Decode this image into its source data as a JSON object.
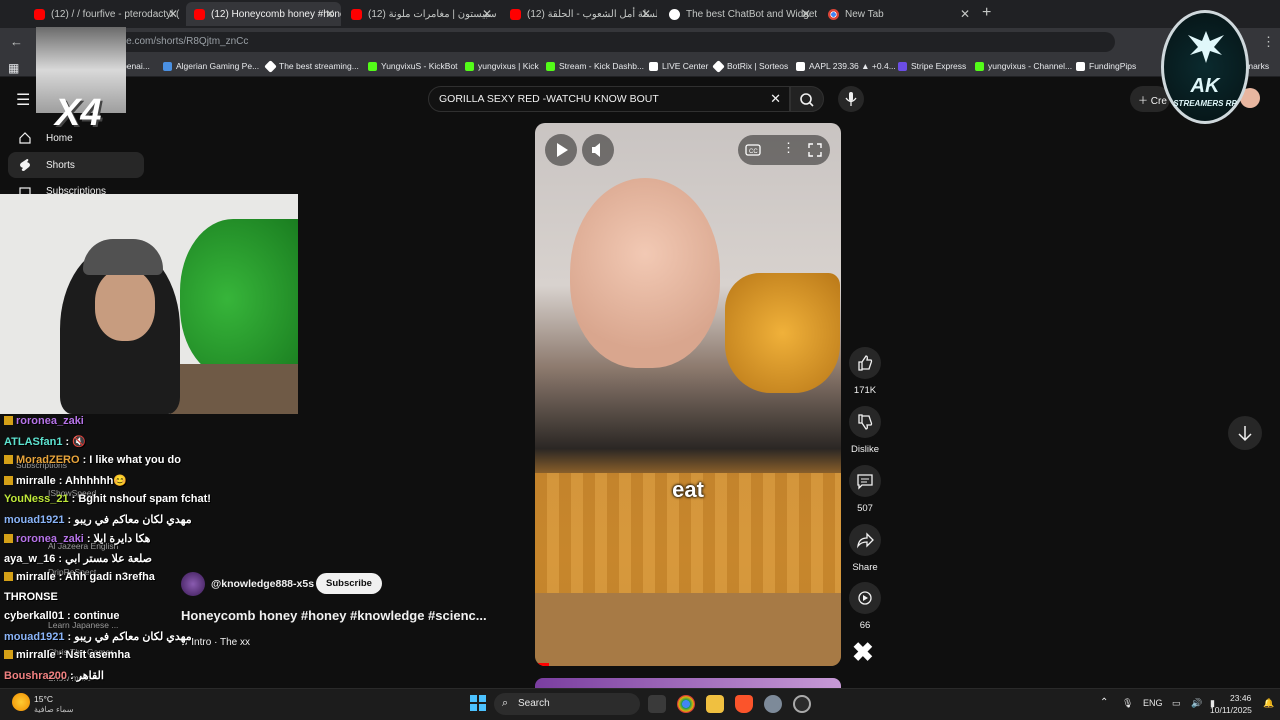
{
  "browser": {
    "tabs": [
      {
        "label": "(12) / / fourfive - pterodactyl (",
        "active": false,
        "icon": "youtube-icon"
      },
      {
        "label": "(12) Honeycomb honey #honey",
        "active": true,
        "icon": "youtube-icon"
      },
      {
        "label": "(12) سبيستون | مغامرات ملونة -",
        "active": false,
        "icon": "youtube-icon"
      },
      {
        "label": "(12) سلسلة أمل الشعوب - الحلقة",
        "active": false,
        "icon": "youtube-icon"
      },
      {
        "label": "The best ChatBot and Widgets",
        "active": false,
        "icon": "streamelements-icon"
      },
      {
        "label": "New Tab",
        "active": false,
        "icon": "chrome-icon"
      }
    ],
    "url": "ube.com/shorts/R8Qjtm_znCc",
    "bookmarks": [
      "benai...",
      "Algerian Gaming Pe...",
      "The best streaming...",
      "YungvixuS - KickBot",
      "yungvixus | Kick",
      "Stream - Kick Dashb...",
      "LIVE Center",
      "BotRix | Sorteos",
      "AAPL 239.36 ▲ +0.4...",
      "Stripe Express",
      "yungvixus - Channel...",
      "FundingPips",
      "marks"
    ]
  },
  "youtube": {
    "search_value": "GORILLA SEXY RED -WATCHU KNOW BOUT",
    "create_label": "Cre",
    "sidebar": [
      {
        "label": "Home",
        "icon": "home-icon",
        "selected": false
      },
      {
        "label": "Shorts",
        "icon": "shorts-icon",
        "selected": true
      },
      {
        "label": "Subscriptions",
        "icon": "subscriptions-icon",
        "selected": false
      }
    ],
    "ghost_sidebar": [
      "Subscriptions",
      "IShowSpeed",
      "Al Jazeera English",
      "DripReSpect",
      "Learn Japanese ...",
      "Chris The Gamer",
      "Show more"
    ],
    "video": {
      "caption": "eat",
      "channel": "@knowledge888-x5s",
      "subscribe_label": "Subscribe",
      "title": "Honeycomb honey #honey #knowledge #scienc...",
      "music": "♫ Intro · The xx"
    },
    "actions": [
      {
        "label": "171K",
        "icon": "like-icon"
      },
      {
        "label": "Dislike",
        "icon": "dislike-icon"
      },
      {
        "label": "507",
        "icon": "comment-icon"
      },
      {
        "label": "Share",
        "icon": "share-icon"
      },
      {
        "label": "66",
        "icon": "remix-icon"
      }
    ]
  },
  "stream_overlay": {
    "multiplier": "X4",
    "logo_text": "AK",
    "logo_sub": "STREAMERS RP",
    "chat": [
      {
        "user": "roronea_zaki",
        "msg": "",
        "color": "#b673e8",
        "badge": true
      },
      {
        "user": "ATLASfan1",
        "msg": ": 🔇",
        "color": "#5ee3d0",
        "badge": false
      },
      {
        "user": "MoradZERO",
        "msg": ": I like what you do",
        "color": "#e9a53b",
        "badge": true
      },
      {
        "user": "mirralle",
        "msg": ": Ahhhhhh😊",
        "color": "#ffffff",
        "badge": true
      },
      {
        "user": "YouNess_21",
        "msg": ": Bghit nshouf spam fchat!",
        "color": "#bfe83a",
        "badge": false
      },
      {
        "user": "mouad1921",
        "msg": ": مهدي لكان معاكم في ريبو",
        "color": "#8ab4f8",
        "badge": false
      },
      {
        "user": "roronea_zaki",
        "msg": ": هكا دايرة ايلا",
        "color": "#b673e8",
        "badge": true
      },
      {
        "user": "aya_w_16",
        "msg": ": صلعة علا مستر ابي",
        "color": "#ffffff",
        "badge": false
      },
      {
        "user": "mirralle",
        "msg": ": Ahh gadi n3refha",
        "color": "#ffffff",
        "badge": true
      },
      {
        "user": "THRONSE",
        "msg": "",
        "color": "#ffffff",
        "badge": false
      },
      {
        "user": "cyberkall01",
        "msg": ": continue",
        "color": "#ffffff",
        "badge": false
      },
      {
        "user": "mouad1921",
        "msg": ": مهدي لكان معاكم في ريبو",
        "color": "#8ab4f8",
        "badge": false
      },
      {
        "user": "mirralle",
        "msg": ": Nsit asemha",
        "color": "#ffffff",
        "badge": true
      },
      {
        "user": "Boushra200",
        "msg": ": القاهر",
        "color": "#f08080",
        "badge": false
      }
    ]
  },
  "taskbar": {
    "weather_temp": "15°C",
    "weather_desc": "سماء صافية",
    "search_label": "Search",
    "lang": "ENG",
    "time": "23:46",
    "date": "10/11/2025"
  }
}
